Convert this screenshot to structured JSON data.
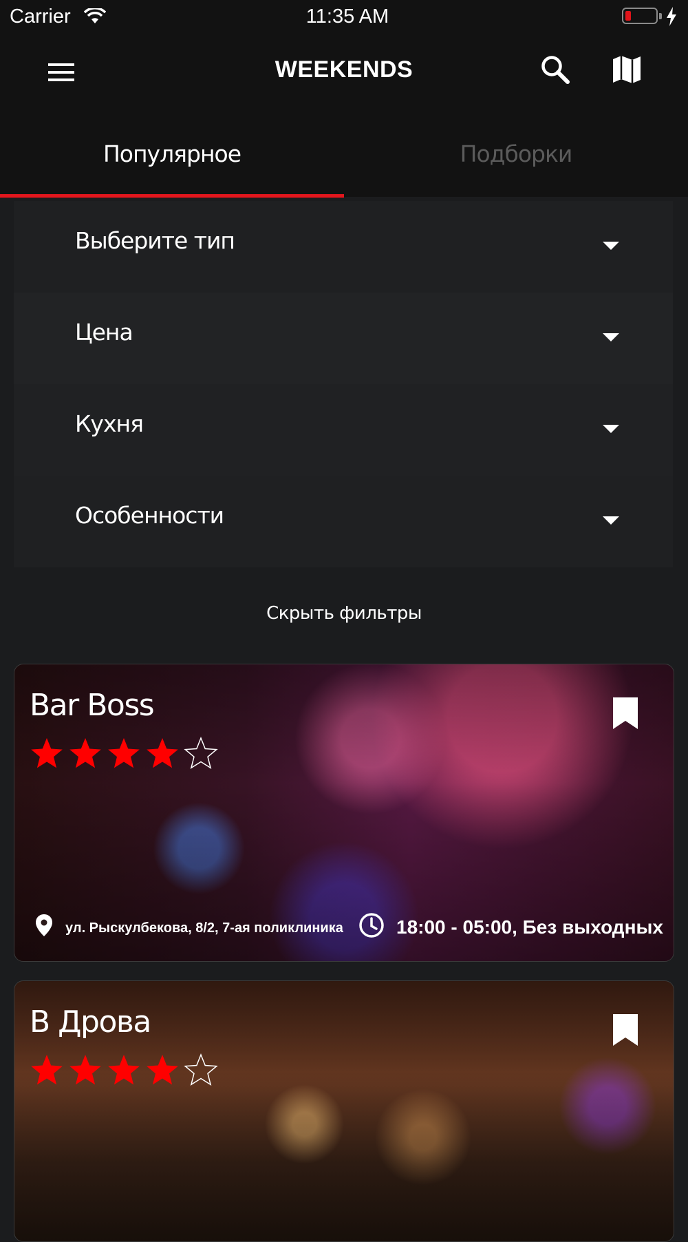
{
  "status": {
    "carrier": "Carrier",
    "time": "11:35 AM"
  },
  "header": {
    "title": "WEEKENDS",
    "icons": [
      "menu-icon",
      "search-icon",
      "map-icon"
    ]
  },
  "tabs": [
    {
      "label": "Популярное",
      "active": true
    },
    {
      "label": "Подборки",
      "active": false
    }
  ],
  "filters": [
    {
      "label": "Выберите тип"
    },
    {
      "label": "Цена"
    },
    {
      "label": "Кухня"
    },
    {
      "label": "Особенности"
    }
  ],
  "hide_filters_label": "Скрыть фильтры",
  "places": [
    {
      "name": "Bar Boss",
      "rating": 4,
      "rating_max": 5,
      "address": "ул. Рыскулбекова, 8/2, 7-ая поликлиника",
      "hours": "18:00 - 05:00, Без выходных"
    },
    {
      "name": "В Дрова",
      "rating": 4,
      "rating_max": 5
    }
  ],
  "colors": {
    "accent": "#e3161d",
    "star": "#ff0000",
    "background": "#1b1c1e",
    "bar": "#121212"
  }
}
